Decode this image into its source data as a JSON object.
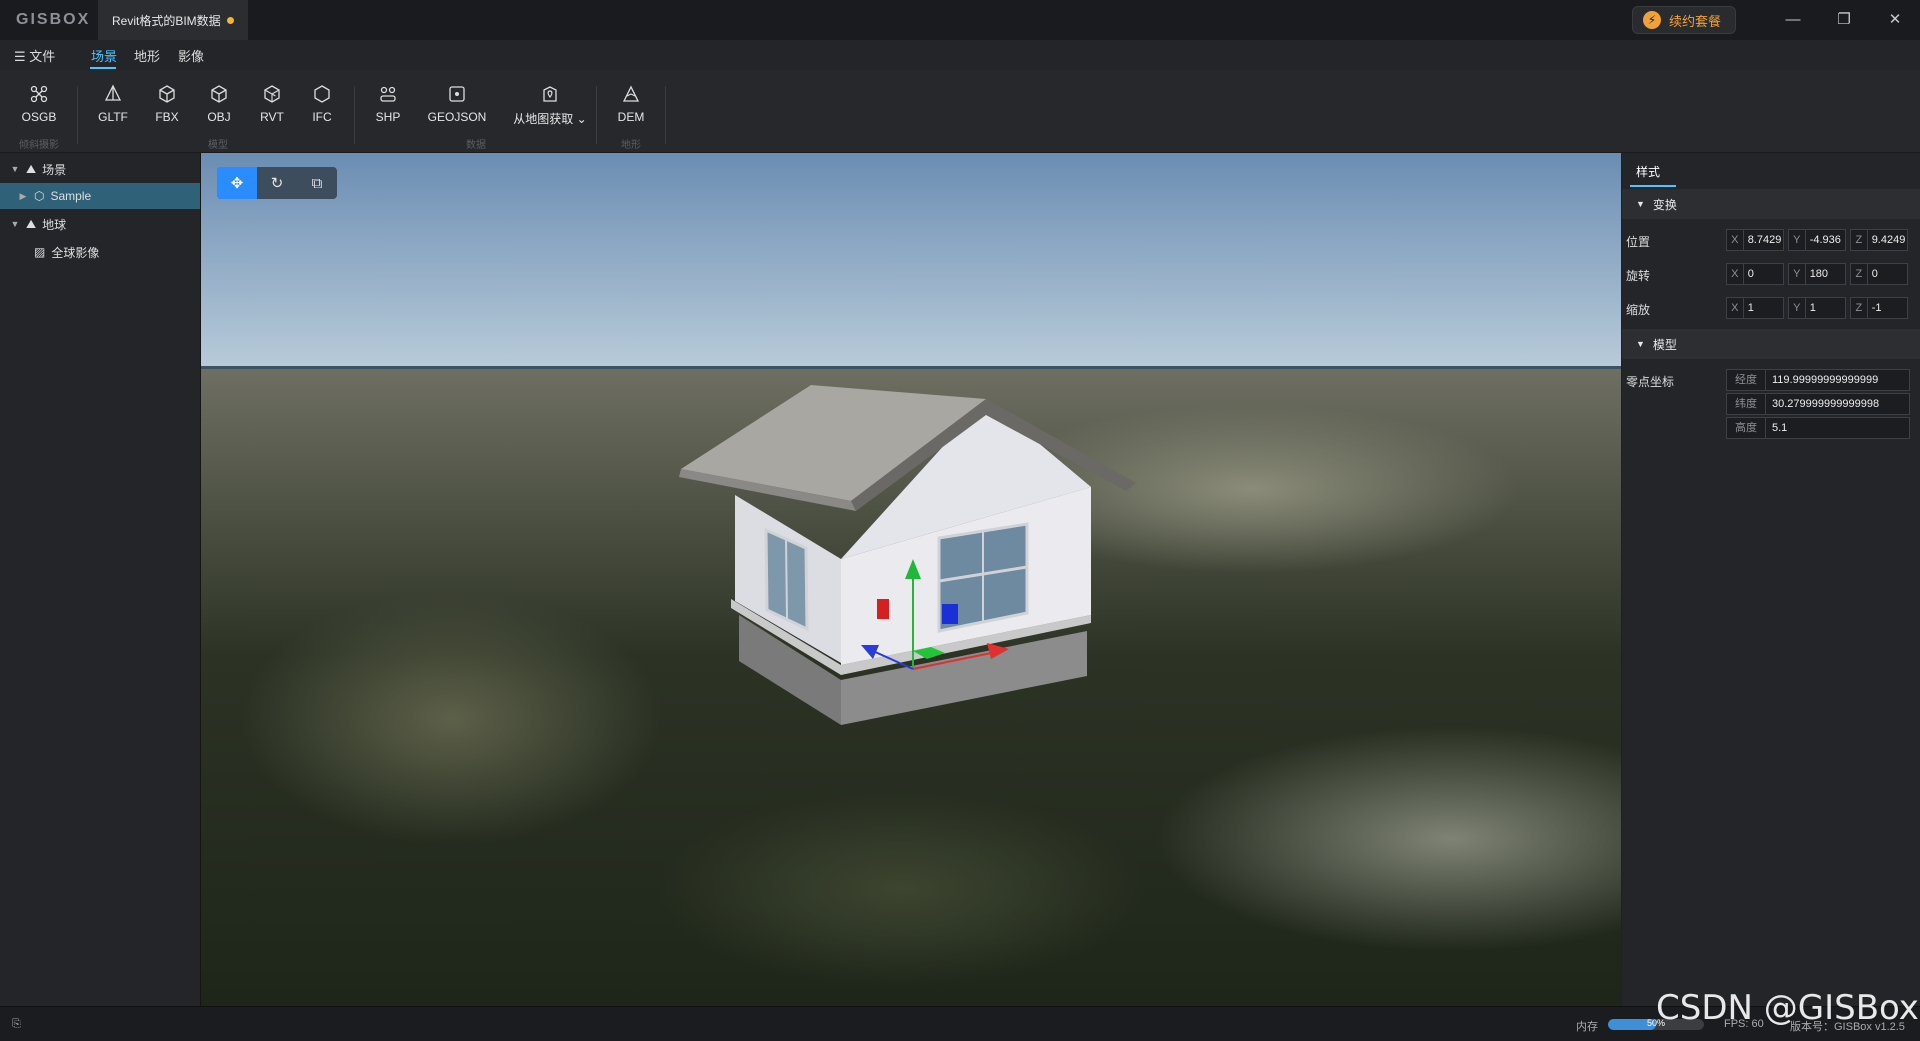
{
  "app": {
    "logo": "GISBOX",
    "document_tab": "Revit格式的BIM数据",
    "renew_label": "续约套餐"
  },
  "window_controls": {
    "minimize": "—",
    "restore": "❐",
    "close": "✕"
  },
  "menu": {
    "file": "文件",
    "tabs": [
      "场景",
      "地形",
      "影像"
    ],
    "active_tab": "场景"
  },
  "toolbar": {
    "tools": [
      "OSGB",
      "GLTF",
      "FBX",
      "OBJ",
      "RVT",
      "IFC",
      "SHP",
      "GEOJSON",
      "从地图获取",
      "DEM"
    ],
    "groups": [
      "倾斜摄影",
      "模型",
      "数据",
      "地形"
    ]
  },
  "tree": {
    "scene": "场景",
    "sample": "Sample",
    "globe": "地球",
    "imagery": "全球影像"
  },
  "viewport": {
    "tool_icons": [
      "move-icon",
      "rotate-icon",
      "scale-icon"
    ]
  },
  "properties": {
    "tab": "样式",
    "transform_section": "变换",
    "position_label": "位置",
    "rotation_label": "旋转",
    "scale_label": "缩放",
    "axis_x": "X",
    "axis_y": "Y",
    "axis_z": "Z",
    "position": {
      "x": "8.7429",
      "y": "-4.936",
      "z": "9.4249"
    },
    "rotation": {
      "x": "0",
      "y": "180",
      "z": "0"
    },
    "scale": {
      "x": "1",
      "y": "1",
      "z": "-1"
    },
    "model_section": "模型",
    "origin_label": "零点坐标",
    "longitude_label": "经度",
    "latitude_label": "纬度",
    "height_label": "高度",
    "longitude": "119.99999999999999",
    "latitude": "30.279999999999998",
    "height": "5.1"
  },
  "status": {
    "memory_label": "内存",
    "memory_percent": "50%",
    "memory_fraction": 0.5,
    "fps": "FPS: 60",
    "version": "版本号：GISBox v1.2.5"
  },
  "watermark": "CSDN @GISBox",
  "colors": {
    "accent": "#4fc3ff",
    "selected": "#2f6178",
    "active_tool": "#2b8cff",
    "unsaved_dot": "#f2b632"
  }
}
